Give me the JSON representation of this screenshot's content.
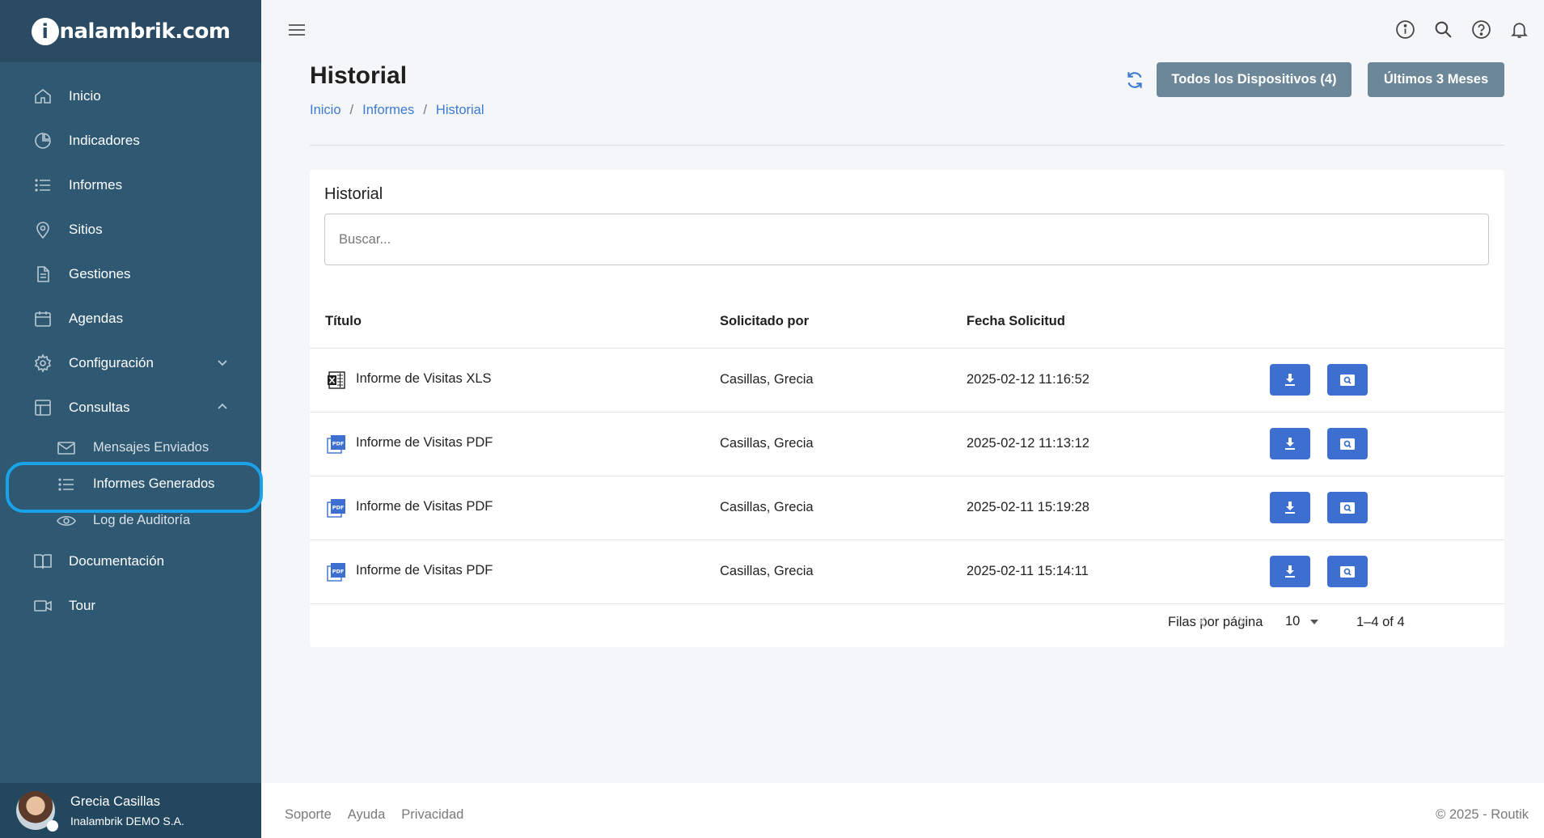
{
  "brand": {
    "logo_letter": "i",
    "logo_rest": "nalambrik.com"
  },
  "sidebar": {
    "items": [
      {
        "label": "Inicio",
        "icon": "home-icon"
      },
      {
        "label": "Indicadores",
        "icon": "pie-chart-icon"
      },
      {
        "label": "Informes",
        "icon": "list-icon"
      },
      {
        "label": "Sitios",
        "icon": "map-pin-icon"
      },
      {
        "label": "Gestiones",
        "icon": "document-icon"
      },
      {
        "label": "Agendas",
        "icon": "calendar-icon"
      },
      {
        "label": "Configuración",
        "icon": "gear-icon"
      },
      {
        "label": "Consultas",
        "icon": "table-icon"
      }
    ],
    "sub_items": [
      {
        "label": "Mensajes Enviados",
        "icon": "mail-icon"
      },
      {
        "label": "Informes Generados",
        "icon": "list-icon"
      },
      {
        "label": "Log de Auditoría",
        "icon": "eye-icon"
      }
    ],
    "bottom_items": [
      {
        "label": "Documentación",
        "icon": "book-icon"
      },
      {
        "label": "Tour",
        "icon": "video-icon"
      }
    ],
    "user": {
      "name": "Grecia Casillas",
      "org": "Inalambrik DEMO S.A."
    }
  },
  "header": {
    "title": "Historial",
    "breadcrumb": [
      "Inicio",
      "Informes",
      "Historial"
    ],
    "separator": "/",
    "devices_button": "Todos los Dispositivos (4)",
    "range_button": "Últimos 3 Meses"
  },
  "card": {
    "title": "Historial",
    "search_placeholder": "Buscar...",
    "columns": [
      "Título",
      "Solicitado por",
      "Fecha Solicitud"
    ],
    "rows": [
      {
        "title": "Informe de Visitas XLS",
        "type": "xls",
        "requested_by": "Casillas, Grecia",
        "date": "2025-02-12 11:16:52"
      },
      {
        "title": "Informe de Visitas PDF",
        "type": "pdf",
        "requested_by": "Casillas, Grecia",
        "date": "2025-02-12 11:13:12"
      },
      {
        "title": "Informe de Visitas PDF",
        "type": "pdf",
        "requested_by": "Casillas, Grecia",
        "date": "2025-02-11 15:19:28"
      },
      {
        "title": "Informe de Visitas PDF",
        "type": "pdf",
        "requested_by": "Casillas, Grecia",
        "date": "2025-02-11 15:14:11"
      }
    ],
    "pagination": {
      "rows_label": "Filas por página",
      "rows_per_page": "10",
      "range": "1–4 of 4"
    }
  },
  "footer": {
    "links": [
      "Soporte",
      "Ayuda",
      "Privacidad"
    ],
    "copyright": "© 2025 - Routik"
  },
  "colors": {
    "sidebar": "#2f5873",
    "accent": "#3d6fd1",
    "highlight": "#1aa3e8",
    "button_gray": "#6c8797"
  }
}
